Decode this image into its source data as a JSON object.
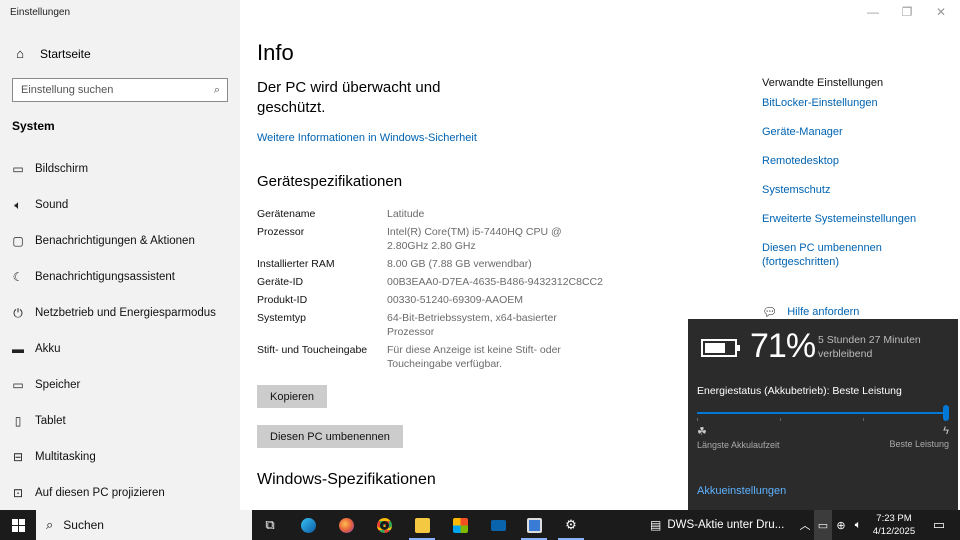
{
  "window": {
    "title": "Einstellungen"
  },
  "sidebar": {
    "home_label": "Startseite",
    "search_placeholder": "Einstellung suchen",
    "section_label": "System",
    "items": [
      {
        "label": "Bildschirm",
        "icon": "monitor-icon"
      },
      {
        "label": "Sound",
        "icon": "speaker-icon"
      },
      {
        "label": "Benachrichtigungen & Aktionen",
        "icon": "notification-icon"
      },
      {
        "label": "Benachrichtigungsassistent",
        "icon": "moon-icon"
      },
      {
        "label": "Netzbetrieb und Energiesparmodus",
        "icon": "power-icon"
      },
      {
        "label": "Akku",
        "icon": "battery-icon"
      },
      {
        "label": "Speicher",
        "icon": "storage-icon"
      },
      {
        "label": "Tablet",
        "icon": "tablet-icon"
      },
      {
        "label": "Multitasking",
        "icon": "multitasking-icon"
      },
      {
        "label": "Auf diesen PC projizieren",
        "icon": "project-icon"
      }
    ]
  },
  "main": {
    "title": "Info",
    "protection_heading": "Der PC wird überwacht und geschützt.",
    "security_link": "Weitere Informationen in Windows-Sicherheit",
    "device_specs_heading": "Gerätespezifikationen",
    "specs": [
      {
        "key": "Gerätename",
        "value": "Latitude"
      },
      {
        "key": "Prozessor",
        "value": "Intel(R) Core(TM) i5-7440HQ CPU @ 2.80GHz   2.80 GHz"
      },
      {
        "key": "Installierter RAM",
        "value": "8.00 GB (7.88 GB verwendbar)"
      },
      {
        "key": "Geräte-ID",
        "value": "00B3EAA0-D7EA-4635-B486-9432312C8CC2"
      },
      {
        "key": "Produkt-ID",
        "value": "00330-51240-69309-AAOEM"
      },
      {
        "key": "Systemtyp",
        "value": "64-Bit-Betriebssystem, x64-basierter Prozessor"
      },
      {
        "key": "Stift- und Toucheingabe",
        "value": "Für diese Anzeige ist keine Stift- oder Toucheingabe verfügbar."
      }
    ],
    "copy_button": "Kopieren",
    "rename_button": "Diesen PC umbenennen",
    "windows_specs_heading": "Windows-Spezifikationen",
    "related": {
      "heading": "Verwandte Einstellungen",
      "links": [
        "BitLocker-Einstellungen",
        "Geräte-Manager",
        "Remotedesktop",
        "Systemschutz",
        "Erweiterte Systemeinstellungen",
        "Diesen PC umbenennen (fortgeschritten)"
      ]
    },
    "help_link": "Hilfe anfordern"
  },
  "battery_flyout": {
    "percent": "71%",
    "percent_value": 0.71,
    "remaining": "5 Stunden 27 Minuten verbleibend",
    "energy_status": "Energiestatus (Akkubetrieb): Beste Leistung",
    "slider_position": 1.0,
    "left_label": "Längste Akkulaufzeit",
    "right_label": "Beste Leistung",
    "settings_link": "Akkueinstellungen"
  },
  "taskbar": {
    "search_label": "Suchen",
    "news_text": "DWS-Aktie unter Dru...",
    "time": "7:23 PM",
    "date": "4/12/2025",
    "apps": [
      "task-view-icon",
      "edge-icon",
      "firefox-icon",
      "chrome-icon",
      "file-explorer-icon",
      "store-icon",
      "mail-icon",
      "remote-app-icon",
      "settings-gear-icon"
    ]
  }
}
